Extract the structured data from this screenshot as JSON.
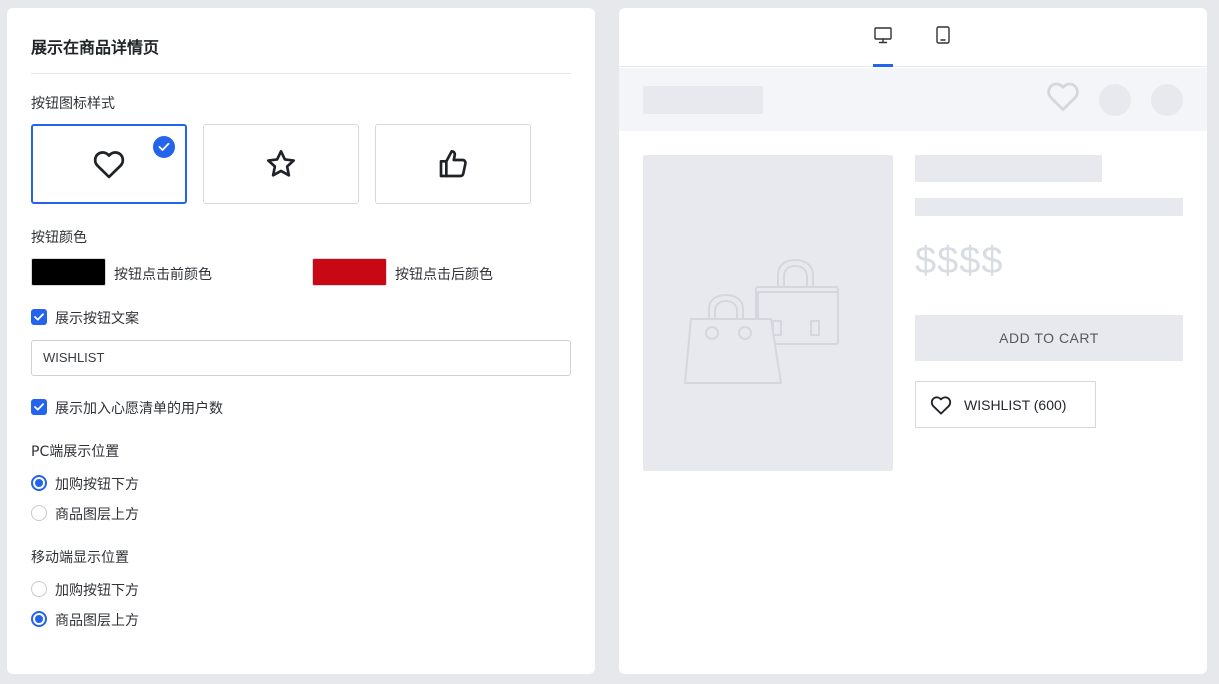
{
  "settings": {
    "title": "展示在商品详情页",
    "icon_style_label": "按钮图标样式",
    "icon_options": [
      {
        "icon": "heart-icon",
        "selected": true
      },
      {
        "icon": "star-icon",
        "selected": false
      },
      {
        "icon": "thumbs-up-icon",
        "selected": false
      }
    ],
    "color_label": "按钮颜色",
    "color_before": {
      "label": "按钮点击前颜色",
      "color": "#000000"
    },
    "color_after": {
      "label": "按钮点击后颜色",
      "color": "#c80814"
    },
    "show_text": {
      "label": "展示按钮文案",
      "checked": true
    },
    "button_text_value": "WISHLIST",
    "show_count": {
      "label": "展示加入心愿清单的用户数",
      "checked": true
    },
    "pc_position": {
      "label": "PC端展示位置",
      "options": [
        {
          "label": "加购按钮下方",
          "selected": true
        },
        {
          "label": "商品图层上方",
          "selected": false
        }
      ]
    },
    "mobile_position": {
      "label": "移动端显示位置",
      "options": [
        {
          "label": "加购按钮下方",
          "selected": false
        },
        {
          "label": "商品图层上方",
          "selected": true
        }
      ]
    }
  },
  "preview": {
    "tabs": [
      {
        "icon": "desktop-icon",
        "active": true
      },
      {
        "icon": "tablet-icon",
        "active": false
      }
    ],
    "price": "$$$$",
    "add_to_cart": "ADD TO CART",
    "wishlist_button": "WISHLIST (600)",
    "accent_color": "#2463eb"
  }
}
